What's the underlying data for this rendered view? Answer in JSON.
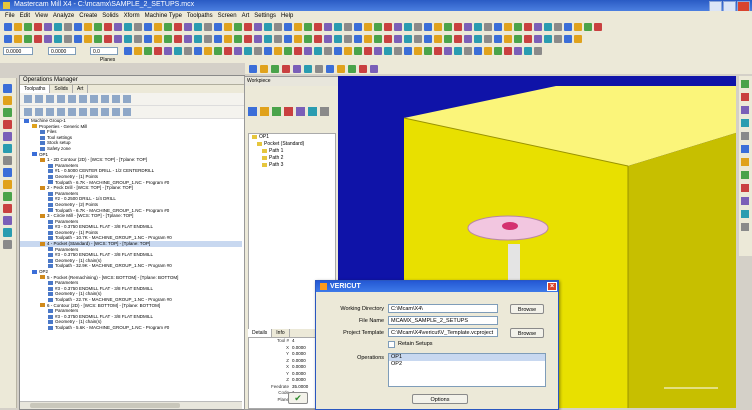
{
  "window": {
    "title": "Mastercam Mill X4 - C:\\mcamx\\SAMPLE_2_SETUPS.mcx"
  },
  "menu": [
    "File",
    "Edit",
    "View",
    "Analyze",
    "Create",
    "Solids",
    "Xform",
    "Machine Type",
    "Toolpaths",
    "Screen",
    "Art",
    "Settings",
    "Help"
  ],
  "toolbar": {
    "field_z": "0.0000",
    "field_z2": "0.0000",
    "field_x": "0.0",
    "planes_label": "Planes"
  },
  "ops_manager": {
    "title": "Operations Manager",
    "tabs": [
      "Toolpaths",
      "Solids",
      "Art"
    ],
    "rows": [
      {
        "depth": 0,
        "text": "Machine Group-1",
        "kind": "group"
      },
      {
        "depth": 1,
        "text": "Properties - Generic Mill",
        "kind": "folder"
      },
      {
        "depth": 2,
        "text": "Files",
        "kind": "item"
      },
      {
        "depth": 2,
        "text": "Tool settings",
        "kind": "item"
      },
      {
        "depth": 2,
        "text": "Stock setup",
        "kind": "item"
      },
      {
        "depth": 2,
        "text": "Safety zone",
        "kind": "item"
      },
      {
        "depth": 1,
        "text": "OP1",
        "kind": "group"
      },
      {
        "depth": 2,
        "text": "1 - 2D Contour (2D) - [WCS: TOP] - [Tplane: TOP]",
        "kind": "op"
      },
      {
        "depth": 3,
        "text": "Parameters",
        "kind": "item"
      },
      {
        "depth": 3,
        "text": "#1 - 0.5000 CENTER DRILL - 1/2 CENTERDRILL",
        "kind": "item"
      },
      {
        "depth": 3,
        "text": "Geometry - (1) Points",
        "kind": "item"
      },
      {
        "depth": 3,
        "text": "Toolpath - 6.7K - MACHINE_GROUP_1.NC - Program #0",
        "kind": "item"
      },
      {
        "depth": 2,
        "text": "2 - Peck Drill - [WCS: TOP] - [Tplane: TOP]",
        "kind": "op"
      },
      {
        "depth": 3,
        "text": "Parameters",
        "kind": "item"
      },
      {
        "depth": 3,
        "text": "#2 - 0.2500 DRILL - 1/4 DRILL",
        "kind": "item"
      },
      {
        "depth": 3,
        "text": "Geometry - (2) Points",
        "kind": "item"
      },
      {
        "depth": 3,
        "text": "Toolpath - 6.7K - MACHINE_GROUP_1.NC - Program #0",
        "kind": "item"
      },
      {
        "depth": 2,
        "text": "3 - Circle Mill - [WCS: TOP] - [Tplane: TOP]",
        "kind": "op"
      },
      {
        "depth": 3,
        "text": "Parameters",
        "kind": "item"
      },
      {
        "depth": 3,
        "text": "#3 - 0.3750 ENDMILL FLAT - 3/8 FLAT ENDMILL",
        "kind": "item"
      },
      {
        "depth": 3,
        "text": "Geometry - (1) Points",
        "kind": "item"
      },
      {
        "depth": 3,
        "text": "Toolpath - 10.7K - MACHINE_GROUP_1.NC - Program #0",
        "kind": "item"
      },
      {
        "depth": 2,
        "text": "4 - Pocket (Standard) - [WCS: TOP] - [Tplane: TOP]",
        "kind": "op",
        "selected": true
      },
      {
        "depth": 3,
        "text": "Parameters",
        "kind": "item"
      },
      {
        "depth": 3,
        "text": "#3 - 0.3750 ENDMILL FLAT - 3/8 FLAT ENDMILL",
        "kind": "item"
      },
      {
        "depth": 3,
        "text": "Geometry - (1) chain(s)",
        "kind": "item"
      },
      {
        "depth": 3,
        "text": "Toolpath - 32.9K - MACHINE_GROUP_1.NC - Program #0",
        "kind": "item"
      },
      {
        "depth": 1,
        "text": "OP2",
        "kind": "group"
      },
      {
        "depth": 2,
        "text": "5 - Pocket (Remachining) - [WCS: BOTTOM] - [Tplane: BOTTOM]",
        "kind": "op"
      },
      {
        "depth": 3,
        "text": "Parameters",
        "kind": "item"
      },
      {
        "depth": 3,
        "text": "#3 - 0.3750 ENDMILL FLAT - 3/8 FLAT ENDMILL",
        "kind": "item"
      },
      {
        "depth": 3,
        "text": "Geometry - (1) chain(s)",
        "kind": "item"
      },
      {
        "depth": 3,
        "text": "Toolpath - 22.7K - MACHINE_GROUP_1.NC - Program #0",
        "kind": "item"
      },
      {
        "depth": 2,
        "text": "6 - Contour (2D) - [WCS: BOTTOM] - [Tplane: BOTTOM]",
        "kind": "op"
      },
      {
        "depth": 3,
        "text": "Parameters",
        "kind": "item"
      },
      {
        "depth": 3,
        "text": "#3 - 0.3750 ENDMILL FLAT - 3/8 FLAT ENDMILL",
        "kind": "item"
      },
      {
        "depth": 3,
        "text": "Geometry - (1) chain(s)",
        "kind": "item"
      },
      {
        "depth": 3,
        "text": "Toolpath - 5.6K - MACHINE_GROUP_1.NC - Program #0",
        "kind": "item"
      }
    ]
  },
  "toolbox": {
    "title": "Workpiece",
    "tree": [
      "OP1",
      "Pocket (Standard)",
      "Path 1",
      "Path 2",
      "Path 3"
    ],
    "tabs": [
      "Details",
      "Info"
    ],
    "props": [
      {
        "label": "Tool #",
        "value": "4"
      },
      {
        "label": "X",
        "value": "0.0000"
      },
      {
        "label": "Y",
        "value": "0.0000"
      },
      {
        "label": "Z",
        "value": "0.0000"
      },
      {
        "label": "X",
        "value": "0.0000"
      },
      {
        "label": "Y",
        "value": "0.0000"
      },
      {
        "label": "Z",
        "value": "0.0000"
      },
      {
        "label": "Feedrate",
        "value": "35.0000"
      },
      {
        "label": "Code",
        "value": "1"
      },
      {
        "label": "Plane",
        "value": "XY"
      }
    ]
  },
  "viewport": {
    "colors": {
      "bg": "#0f13a8",
      "block": "#f5ef00",
      "part": "#f2c6e0",
      "holder": "#2f8a2f"
    }
  },
  "dialog": {
    "title": "VERICUT",
    "working_dir_label": "Working Directory",
    "working_dir": "C:\\Mcam\\X4\\",
    "file_name_label": "File Name",
    "file_name": "MCAMX_SAMPLE_2_SETUPS",
    "project_template_label": "Project Template",
    "project_template": "C:\\Mcam\\X4\\vericut\\V_Template.vcproject",
    "browse_label": "Browse",
    "retain_label": "Retain Setups",
    "operations_label": "Operations",
    "operations": [
      "OP1",
      "OP2"
    ],
    "options_label": "Options"
  }
}
